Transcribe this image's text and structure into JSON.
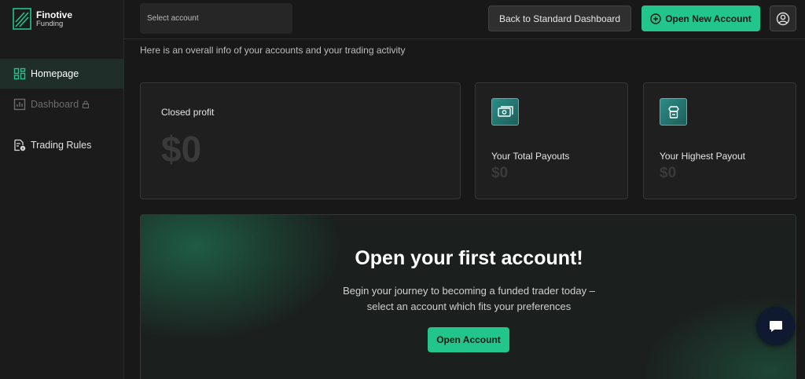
{
  "brand": {
    "name": "Finotive",
    "sub": "Funding",
    "accent": "#22c58b"
  },
  "sidebar": {
    "items": [
      {
        "label": "Homepage",
        "icon": "grid-icon",
        "active": true
      },
      {
        "label": "Dashboard",
        "icon": "chart-icon",
        "locked": true
      },
      {
        "label": "Trading Rules",
        "icon": "document-info-icon"
      }
    ]
  },
  "topbar": {
    "account_select_placeholder": "Select account",
    "back_label": "Back to Standard Dashboard",
    "open_new_label": "Open New Account",
    "profile_icon": "user-circle-icon"
  },
  "main": {
    "intro": "Here is an overall info of your accounts and your trading activity",
    "closed_profit": {
      "label": "Closed profit",
      "value": "$0"
    },
    "total_payouts": {
      "label": "Your Total Payouts",
      "value": "$0",
      "icon": "cash-icon"
    },
    "highest_payout": {
      "label": "Your Highest Payout",
      "value": "$0",
      "icon": "badge-icon"
    },
    "hero": {
      "title": "Open your first account!",
      "line1": "Begin your journey to becoming a funded trader today –",
      "line2": "select an account which fits your preferences",
      "button": "Open Account"
    }
  },
  "chat": {
    "icon": "chat-bubble-icon"
  }
}
